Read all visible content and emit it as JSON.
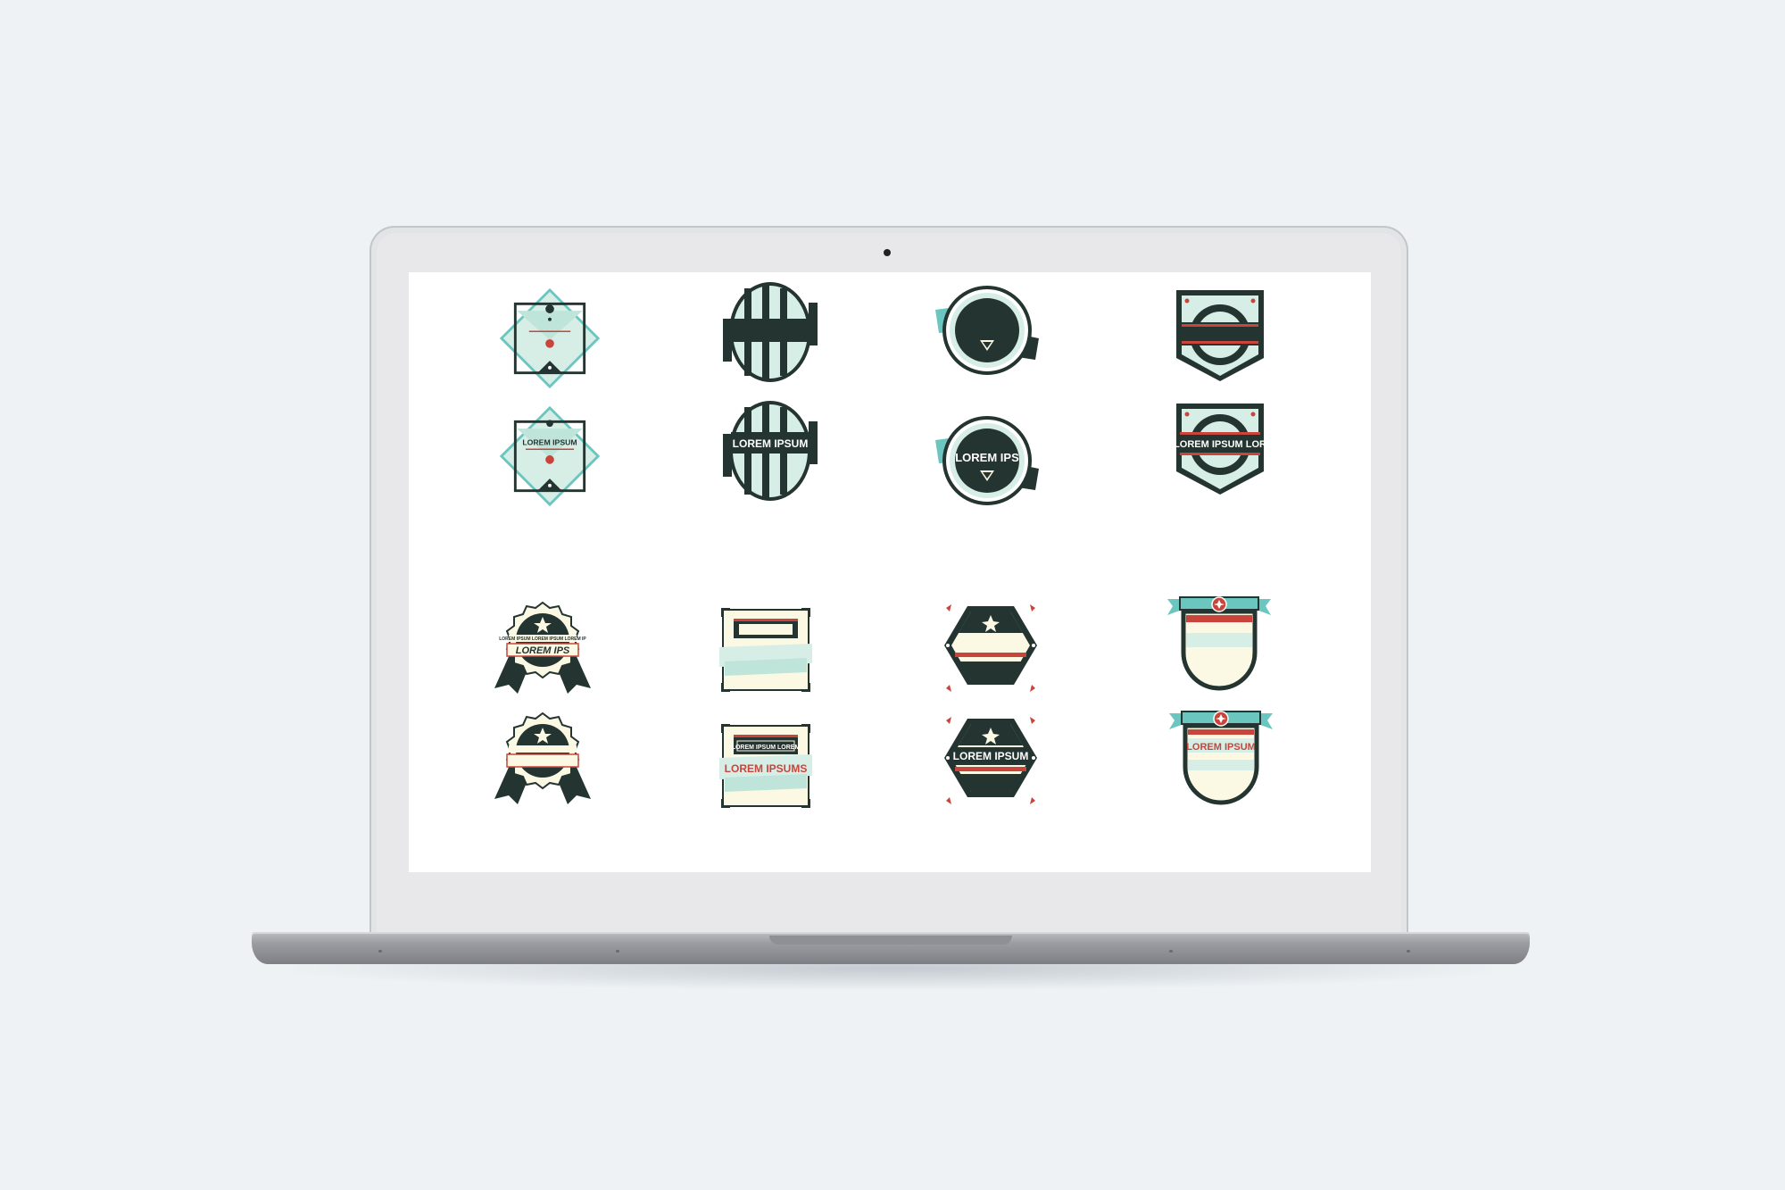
{
  "badges": {
    "b2_text": "LOREM IPSUM",
    "b4_text": "LOREM IPSUM",
    "b6_text": "LOREM IPS",
    "b8_text": "LOREM IPSUM LOR",
    "b9_small": "LOREM IPSUM LOREM IPSUM LOREM IP",
    "b9_text": "LOREM IPS",
    "b12_small": "LOREM IPSUM LOREM",
    "b12_text": "LOREM IPSUMS",
    "b14_text": "LOREM IPSUM",
    "b16_text": "LOREM IPSUM"
  },
  "palette": {
    "dark": "#243431",
    "mint": "#d7eee6",
    "teal": "#6cc6c0",
    "red": "#c9453b",
    "cream": "#fbf8e3"
  }
}
